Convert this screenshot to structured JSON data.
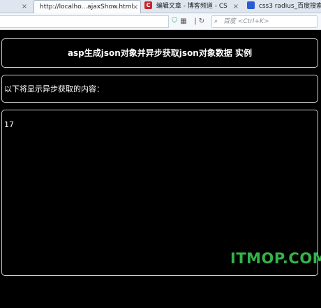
{
  "browser": {
    "tabs": [
      {
        "title": "http://localho...ajaxShow.html",
        "active": true
      },
      {
        "title": "编辑文章 - 博客频道 - CS",
        "icon": "csdn-icon",
        "active": false
      },
      {
        "title": "css3 radius_百度搜索",
        "icon": "baidu-icon",
        "active": false
      }
    ],
    "close_glyph": "×",
    "search_placeholder": "百度 <Ctrl+K>"
  },
  "page": {
    "title": "asp生成json对象并异步获取json对象数据 实例",
    "label": "以下将显示异步获取的内容：",
    "result": "17"
  },
  "watermark": "ITMOP.COM"
}
